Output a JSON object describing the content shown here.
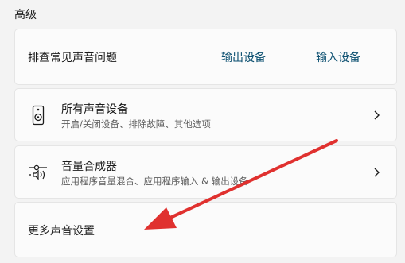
{
  "section_title": "高级",
  "troubleshoot": {
    "label": "排查常见声音问题",
    "output_link": "输出设备",
    "input_link": "输入设备"
  },
  "all_devices": {
    "title": "所有声音设备",
    "subtitle": "开启/关闭设备、排除故障、其他选项",
    "icon": "speaker-icon"
  },
  "mixer": {
    "title": "音量合成器",
    "subtitle": "应用程序音量混合、应用程序输入 & 输出设备",
    "icon": "mixer-icon"
  },
  "more_settings": {
    "label": "更多声音设置"
  },
  "annotation": {
    "arrow_color": "#e0312f"
  },
  "colors": {
    "link": "#0b4f70",
    "card": "#fbfbfb",
    "background": "#f3f3f3"
  }
}
